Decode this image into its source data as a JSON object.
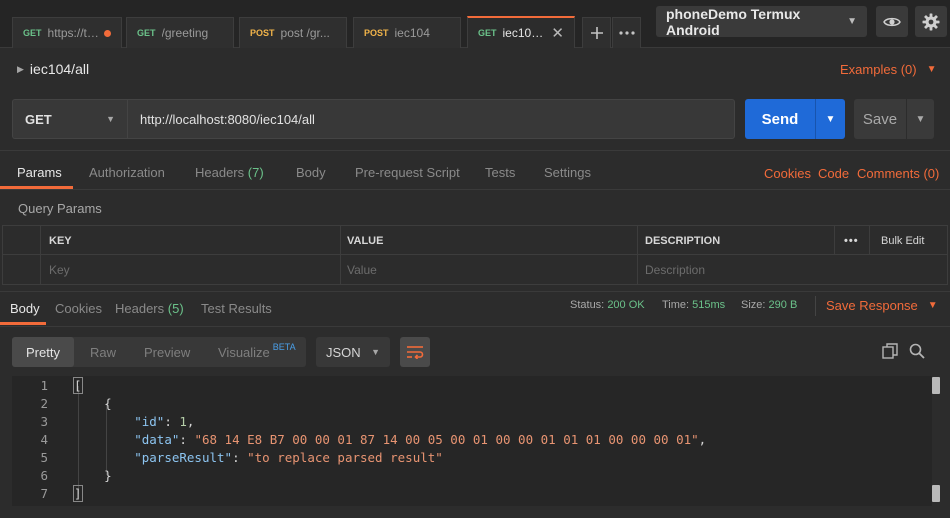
{
  "tabs": [
    {
      "method": "GET",
      "name": "https://tra...",
      "unsaved": true
    },
    {
      "method": "GET",
      "name": "/greeting"
    },
    {
      "method": "POST",
      "name": "post /gr..."
    },
    {
      "method": "POST",
      "name": "iec104"
    },
    {
      "method": "GET",
      "name": "iec104/all",
      "active": true,
      "close": "✕"
    }
  ],
  "tabbar": {
    "add_icon": "plus-icon",
    "more_icon": "ellipsis-icon"
  },
  "environment": {
    "selected": "phoneDemo Termux Android",
    "icons": [
      "eye-icon",
      "gear-icon"
    ]
  },
  "request": {
    "title": "iec104/all",
    "examples": "Examples (0)",
    "method": "GET",
    "url": "http://localhost:8080/iec104/all",
    "send_label": "Send",
    "save_label": "Save"
  },
  "request_tabs": {
    "params": "Params",
    "authorization": "Authorization",
    "headers": "Headers",
    "headers_count": "(7)",
    "body": "Body",
    "pre_request": "Pre-request Script",
    "tests": "Tests",
    "settings": "Settings",
    "cookies": "Cookies",
    "code": "Code",
    "comments": "Comments (0)"
  },
  "query_params": {
    "label": "Query Params",
    "headers": {
      "key": "KEY",
      "value": "VALUE",
      "description": "DESCRIPTION"
    },
    "bulk_edit": "Bulk Edit",
    "placeholders": {
      "key": "Key",
      "value": "Value",
      "description": "Description"
    }
  },
  "response_tabs": {
    "body": "Body",
    "cookies": "Cookies",
    "headers": "Headers",
    "headers_count": "(5)",
    "test_results": "Test Results"
  },
  "response_status": {
    "status_label": "Status:",
    "status_value": "200 OK",
    "time_label": "Time:",
    "time_value": "515ms",
    "size_label": "Size:",
    "size_value": "290 B",
    "save_response": "Save Response"
  },
  "formats": {
    "pretty": "Pretty",
    "raw": "Raw",
    "preview": "Preview",
    "visualize": "Visualize",
    "visualize_badge": "BETA",
    "language": "JSON"
  },
  "code": {
    "line_numbers": [
      "1",
      "2",
      "3",
      "4",
      "5",
      "6",
      "7"
    ],
    "open_bracket": "[",
    "open_brace": "{",
    "id_key": "\"id\"",
    "id_value": "1",
    "data_key": "\"data\"",
    "data_value": "\"68 14 E8 B7 00 00 01 87 14 00 05 00 01 00 00 01 01 01 00 00 00 01\"",
    "parse_key": "\"parseResult\"",
    "parse_value": "\"to replace parsed result\"",
    "close_brace": "}",
    "close_bracket": "]"
  },
  "colors": {
    "accent": "#f26b3a",
    "send": "#1f6ad8",
    "get": "#6bc28a",
    "post": "#f2b44a"
  }
}
